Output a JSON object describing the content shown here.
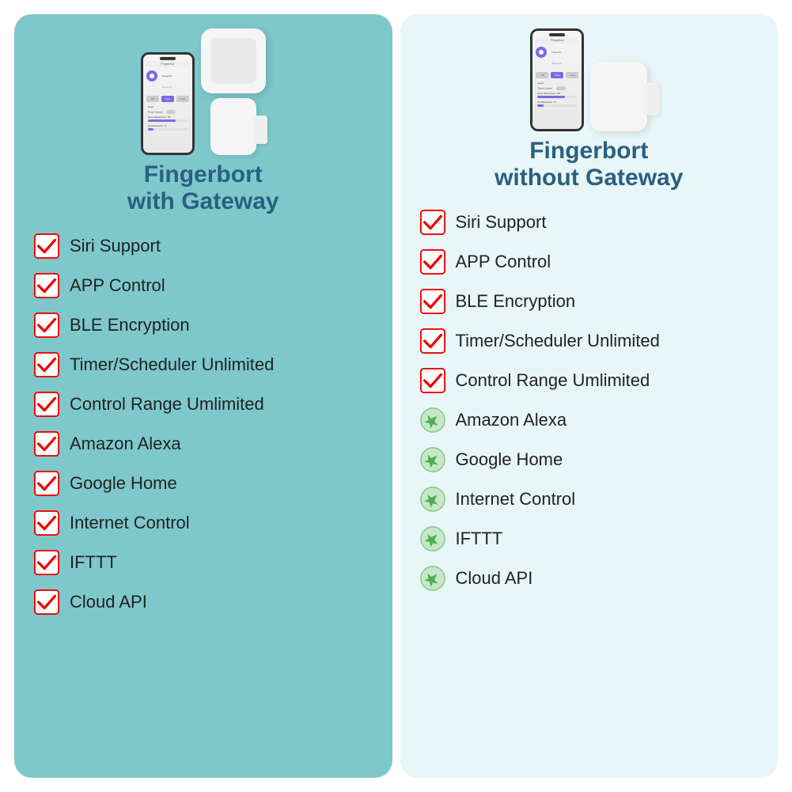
{
  "left_column": {
    "title_line1": "Fingerbort",
    "title_line2": "with Gateway",
    "features": [
      {
        "text": "Siri Support",
        "icon": "checkmark"
      },
      {
        "text": "APP Control",
        "icon": "checkmark"
      },
      {
        "text": "BLE Encryption",
        "icon": "checkmark"
      },
      {
        "text": "Timer/Scheduler Unlimited",
        "icon": "checkmark"
      },
      {
        "text": "Control Range Umlimited",
        "icon": "checkmark"
      },
      {
        "text": "Amazon Alexa",
        "icon": "checkmark"
      },
      {
        "text": "Google Home",
        "icon": "checkmark"
      },
      {
        "text": "Internet Control",
        "icon": "checkmark"
      },
      {
        "text": "IFTTT",
        "icon": "checkmark"
      },
      {
        "text": "Cloud API",
        "icon": "checkmark"
      }
    ]
  },
  "right_column": {
    "title_line1": "Fingerbort",
    "title_line2": "without Gateway",
    "features": [
      {
        "text": "Siri Support",
        "icon": "checkmark"
      },
      {
        "text": "APP Control",
        "icon": "checkmark"
      },
      {
        "text": "BLE Encryption",
        "icon": "checkmark"
      },
      {
        "text": "Timer/Scheduler Unlimited",
        "icon": "checkmark"
      },
      {
        "text": "Control Range Umlimited",
        "icon": "checkmark"
      },
      {
        "text": "Amazon Alexa",
        "icon": "unavailable"
      },
      {
        "text": "Google Home",
        "icon": "unavailable"
      },
      {
        "text": "Internet Control",
        "icon": "unavailable"
      },
      {
        "text": "IFTTT",
        "icon": "unavailable"
      },
      {
        "text": "Cloud API",
        "icon": "unavailable"
      }
    ]
  }
}
